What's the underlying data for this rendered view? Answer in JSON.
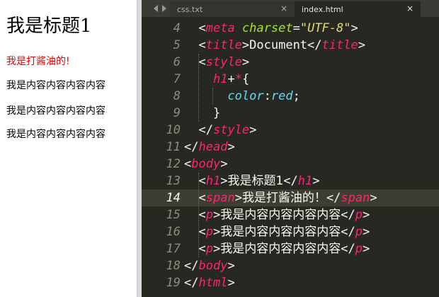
{
  "preview": {
    "h1": "我是标题1",
    "span": "我是打酱油的!",
    "paragraphs": [
      "我是内容内容内容内容",
      "我是内容内容内容内容",
      "我是内容内容内容内容"
    ]
  },
  "editor": {
    "tabs": [
      {
        "label": "css.txt",
        "active": false
      },
      {
        "label": "index.html",
        "active": true
      }
    ],
    "close_glyph": "×",
    "line_numbers": [
      "4",
      "5",
      "6",
      "7",
      "8",
      "9",
      "10",
      "11",
      "12",
      "13",
      "14",
      "15",
      "16",
      "17",
      "18",
      "19"
    ],
    "current_line": "14",
    "lines": [
      {
        "indent": "  ",
        "tokens": [
          {
            "c": "w",
            "t": "<"
          },
          {
            "c": "t",
            "t": "meta"
          },
          {
            "c": "w",
            "t": " "
          },
          {
            "c": "a",
            "t": "charset"
          },
          {
            "c": "w",
            "t": "="
          },
          {
            "c": "s",
            "t": "\"UTF-8\""
          },
          {
            "c": "w",
            "t": ">"
          }
        ]
      },
      {
        "indent": "  ",
        "tokens": [
          {
            "c": "w",
            "t": "<"
          },
          {
            "c": "t",
            "t": "title"
          },
          {
            "c": "w",
            "t": ">Document</"
          },
          {
            "c": "t",
            "t": "title"
          },
          {
            "c": "w",
            "t": ">"
          }
        ]
      },
      {
        "indent": "  ",
        "tokens": [
          {
            "c": "w",
            "t": "<"
          },
          {
            "c": "t",
            "t": "style"
          },
          {
            "c": "w",
            "t": ">"
          }
        ]
      },
      {
        "indent": "    ",
        "tokens": [
          {
            "c": "t",
            "t": "h1"
          },
          {
            "c": "w",
            "t": "+"
          },
          {
            "c": "t",
            "t": "*"
          },
          {
            "c": "w",
            "t": "{"
          }
        ]
      },
      {
        "indent": "      ",
        "tokens": [
          {
            "c": "pr",
            "t": "color"
          },
          {
            "c": "w",
            "t": ":"
          },
          {
            "c": "v",
            "t": "red"
          },
          {
            "c": "w",
            "t": ";"
          }
        ]
      },
      {
        "indent": "    ",
        "tokens": [
          {
            "c": "w",
            "t": "}"
          }
        ]
      },
      {
        "indent": "  ",
        "tokens": [
          {
            "c": "w",
            "t": "</"
          },
          {
            "c": "t",
            "t": "style"
          },
          {
            "c": "w",
            "t": ">"
          }
        ]
      },
      {
        "indent": "",
        "tokens": [
          {
            "c": "w",
            "t": "</"
          },
          {
            "c": "t",
            "t": "head"
          },
          {
            "c": "w",
            "t": ">"
          }
        ]
      },
      {
        "indent": "",
        "tokens": [
          {
            "c": "w",
            "t": "<"
          },
          {
            "c": "t",
            "t": "body"
          },
          {
            "c": "w",
            "t": ">"
          }
        ]
      },
      {
        "indent": "  ",
        "tokens": [
          {
            "c": "w",
            "t": "<"
          },
          {
            "c": "t",
            "t": "h1"
          },
          {
            "c": "w",
            "t": ">"
          },
          {
            "c": "w cjk",
            "t": "我是标题1"
          },
          {
            "c": "w",
            "t": "</"
          },
          {
            "c": "t",
            "t": "h1"
          },
          {
            "c": "w",
            "t": ">"
          }
        ]
      },
      {
        "indent": "  ",
        "tokens": [
          {
            "c": "w",
            "t": "<"
          },
          {
            "c": "t",
            "t": "span"
          },
          {
            "c": "w",
            "t": ">"
          },
          {
            "c": "w cjk",
            "t": "我是打酱油的！"
          },
          {
            "c": "w",
            "t": "</"
          },
          {
            "c": "t",
            "t": "span"
          },
          {
            "c": "w",
            "t": ">"
          }
        ]
      },
      {
        "indent": "  ",
        "tokens": [
          {
            "c": "w",
            "t": "<"
          },
          {
            "c": "t",
            "t": "p"
          },
          {
            "c": "w",
            "t": ">"
          },
          {
            "c": "w cjk",
            "t": "我是内容内容内容内容"
          },
          {
            "c": "w",
            "t": "</"
          },
          {
            "c": "t",
            "t": "p"
          },
          {
            "c": "w",
            "t": ">"
          }
        ]
      },
      {
        "indent": "  ",
        "tokens": [
          {
            "c": "w",
            "t": "<"
          },
          {
            "c": "t",
            "t": "p"
          },
          {
            "c": "w",
            "t": ">"
          },
          {
            "c": "w cjk",
            "t": "我是内容内容内容内容"
          },
          {
            "c": "w",
            "t": "</"
          },
          {
            "c": "t",
            "t": "p"
          },
          {
            "c": "w",
            "t": ">"
          }
        ]
      },
      {
        "indent": "  ",
        "tokens": [
          {
            "c": "w",
            "t": "<"
          },
          {
            "c": "t",
            "t": "p"
          },
          {
            "c": "w",
            "t": ">"
          },
          {
            "c": "w cjk",
            "t": "我是内容内容内容内容"
          },
          {
            "c": "w",
            "t": "</"
          },
          {
            "c": "t",
            "t": "p"
          },
          {
            "c": "w",
            "t": ">"
          }
        ]
      },
      {
        "indent": "",
        "tokens": [
          {
            "c": "w",
            "t": "</"
          },
          {
            "c": "t",
            "t": "body"
          },
          {
            "c": "w",
            "t": ">"
          }
        ]
      },
      {
        "indent": "",
        "tokens": [
          {
            "c": "w",
            "t": "</"
          },
          {
            "c": "t",
            "t": "html"
          },
          {
            "c": "w",
            "t": ">"
          }
        ]
      }
    ]
  },
  "colors": {
    "editor_bg": "#272822",
    "tag": "#f92672",
    "attribute": "#a6e22e",
    "string": "#e6db74",
    "property": "#66d9ef",
    "text": "#f8f8f2",
    "preview_red": "#ee0000"
  }
}
